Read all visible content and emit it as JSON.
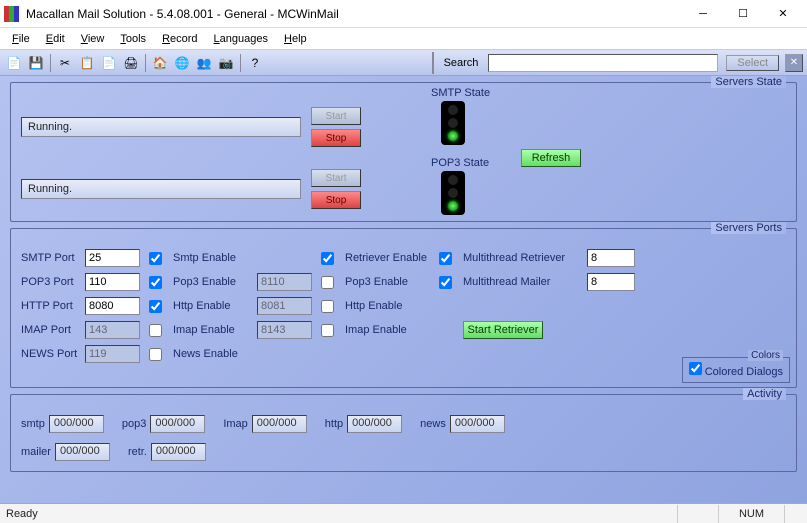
{
  "window": {
    "title": "Macallan Mail Solution - 5.4.08.001 - General - MCWinMail"
  },
  "menu": {
    "file": "File",
    "edit": "Edit",
    "view": "View",
    "tools": "Tools",
    "record": "Record",
    "languages": "Languages",
    "help": "Help"
  },
  "search": {
    "label": "Search",
    "value": "",
    "select": "Select"
  },
  "servers_state": {
    "title": "Servers State",
    "smtp_label": "SMTP State",
    "pop3_label": "POP3 State",
    "smtp_status": "Running.",
    "pop3_status": "Running.",
    "start": "Start",
    "stop": "Stop",
    "refresh": "Refresh"
  },
  "servers_ports": {
    "title": "Servers Ports",
    "labels": {
      "smtp": "SMTP Port",
      "pop3": "POP3 Port",
      "http": "HTTP Port",
      "imap": "IMAP Port",
      "news": "NEWS Port",
      "smtp_en": "Smtp Enable",
      "pop3_en": "Pop3 Enable",
      "http_en": "Http Enable",
      "imap_en": "Imap Enable",
      "news_en": "News Enable",
      "retr_en": "Retriever Enable",
      "pop3_en2": "Pop3 Enable",
      "http_en2": "Http Enable",
      "imap_en2": "Imap Enable",
      "mt_retr": "Multithread Retriever",
      "mt_mail": "Multithread Mailer",
      "start_retr": "Start Retriever"
    },
    "values": {
      "smtp": "25",
      "pop3": "110",
      "http": "8080",
      "imap": "143",
      "news": "119",
      "pop3_2": "8110",
      "http_2": "8081",
      "imap_2": "8143",
      "mt_retr": "8",
      "mt_mail": "8"
    },
    "checks": {
      "smtp_en": true,
      "pop3_en": true,
      "http_en": true,
      "imap_en": false,
      "news_en": false,
      "retr_en": true,
      "pop3_en2": false,
      "http_en2": false,
      "imap_en2": false,
      "mt_retr": true,
      "mt_mail": true
    }
  },
  "colors": {
    "title": "Colors",
    "label": "Colored Dialogs",
    "checked": true
  },
  "activity": {
    "title": "Activity",
    "items": {
      "smtp": "smtp",
      "pop3": "pop3",
      "imap": "Imap",
      "http": "http",
      "news": "news",
      "mailer": "mailer",
      "retr": "retr."
    },
    "val": "000/000"
  },
  "status": {
    "ready": "Ready",
    "num": "NUM"
  }
}
